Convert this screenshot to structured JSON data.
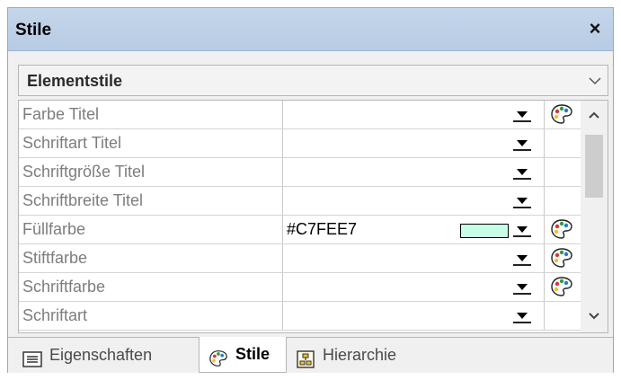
{
  "window": {
    "title": "Stile",
    "close_label": "×"
  },
  "dropdown": {
    "selected": "Elementstile"
  },
  "rows": [
    {
      "name": "Farbe Titel",
      "value": "",
      "swatch": null,
      "palette": true
    },
    {
      "name": "Schriftart Titel",
      "value": "",
      "swatch": null,
      "palette": false
    },
    {
      "name": "Schriftgröße Titel",
      "value": "",
      "swatch": null,
      "palette": false
    },
    {
      "name": "Schriftbreite Titel",
      "value": "",
      "swatch": null,
      "palette": false
    },
    {
      "name": "Füllfarbe",
      "value": "#C7FEE7",
      "swatch": "#C7FEE7",
      "palette": true
    },
    {
      "name": "Stiftfarbe",
      "value": "",
      "swatch": null,
      "palette": true
    },
    {
      "name": "Schriftfarbe",
      "value": "",
      "swatch": null,
      "palette": true
    },
    {
      "name": "Schriftart",
      "value": "",
      "swatch": null,
      "palette": false
    }
  ],
  "tabs": [
    {
      "label": "Eigenschaften",
      "icon": "list-icon",
      "active": false
    },
    {
      "label": "Stile",
      "icon": "palette-icon",
      "active": true
    },
    {
      "label": "Hierarchie",
      "icon": "hierarchy-icon",
      "active": false
    }
  ]
}
